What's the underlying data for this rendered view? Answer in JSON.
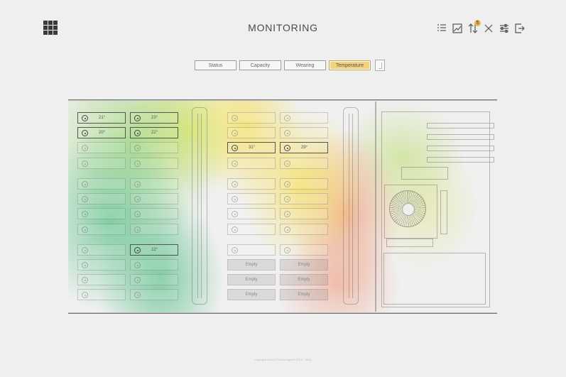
{
  "header": {
    "title": "MONITORING",
    "badge_count": "5"
  },
  "toolbar": [
    {
      "name": "list-icon"
    },
    {
      "name": "chart-icon"
    },
    {
      "name": "sort-icon",
      "badge": true
    },
    {
      "name": "close-icon"
    },
    {
      "name": "sliders-icon"
    },
    {
      "name": "logout-icon"
    }
  ],
  "tabs": [
    {
      "label": "Status",
      "active": false
    },
    {
      "label": "Capacity",
      "active": false
    },
    {
      "label": "Wearing",
      "active": false
    },
    {
      "label": "Temperature",
      "active": true
    }
  ],
  "racks": {
    "left_col1": [
      "21°",
      "20°",
      "",
      "",
      "",
      "",
      "",
      "",
      "",
      "",
      "",
      ""
    ],
    "left_col2": [
      "23°",
      "22°",
      "",
      "",
      "",
      "",
      "",
      "",
      "22°",
      "",
      "",
      ""
    ],
    "mid_col1": [
      "",
      "",
      "31°",
      "",
      "",
      "",
      "",
      "",
      "",
      "Empty",
      "Empty",
      "Empty"
    ],
    "mid_col2": [
      "",
      "",
      "29°",
      "",
      "",
      "",
      "",
      "",
      "",
      "Empty",
      "Empty",
      "Empty"
    ]
  },
  "colors": {
    "active_tab": "#f3d27a",
    "cool": "#6ec896",
    "warm": "#f5e16e",
    "hot": "#f0aa8c"
  },
  "footer": {
    "copyright": "copyright FAULD Technologies® 2015 - 2016"
  }
}
